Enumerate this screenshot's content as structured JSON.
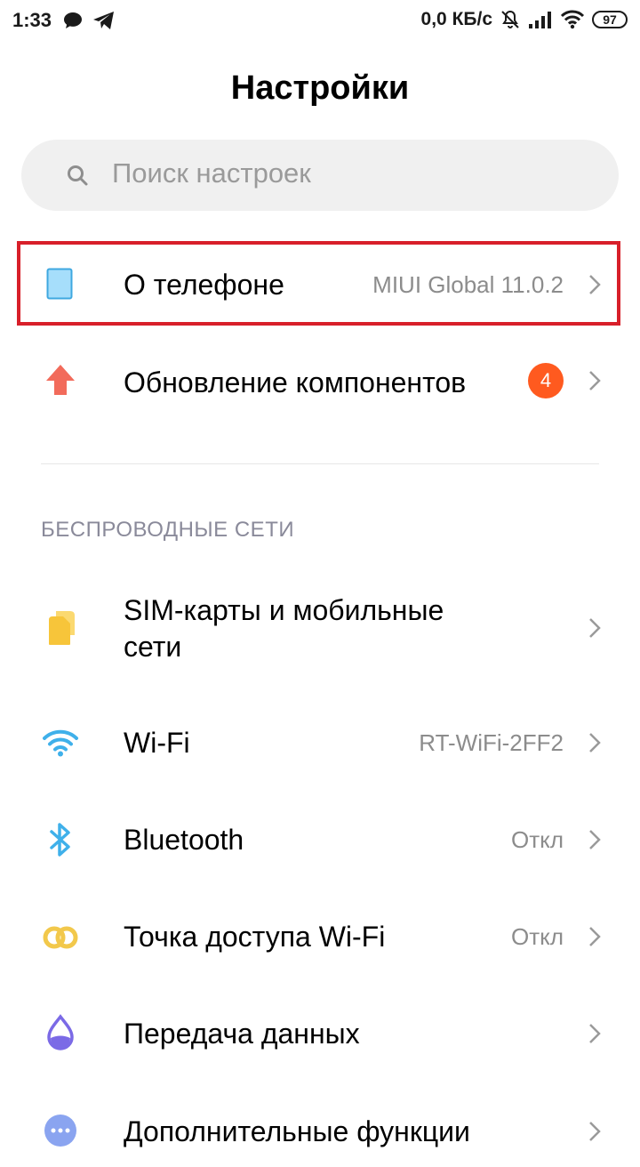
{
  "status_bar": {
    "time": "1:33",
    "net_speed": "0,0 КБ/с",
    "battery": "97",
    "icons": [
      "chat-icon",
      "telegram-icon",
      "bell-muted-icon",
      "signal-icon",
      "wifi-icon",
      "battery-icon"
    ]
  },
  "page": {
    "title": "Настройки"
  },
  "search": {
    "placeholder": "Поиск настроек"
  },
  "items": {
    "about": {
      "label": "О телефоне",
      "value": "MIUI Global 11.0.2",
      "icon": "phone-icon",
      "color": "#8fd3f0"
    },
    "updates": {
      "label": "Обновление компонентов",
      "badge": "4",
      "icon": "arrow-up-icon",
      "color": "#f26b5b"
    },
    "sim": {
      "label_line1": "SIM-карты и мобильные",
      "label_line2": "сети",
      "icon": "sim-cards-icon",
      "color": "#f7c53a"
    },
    "wifi": {
      "label": "Wi-Fi",
      "value": "RT-WiFi-2FF2",
      "icon": "wifi-icon",
      "color": "#3fb0ea"
    },
    "bluetooth": {
      "label": "Bluetooth",
      "value": "Откл",
      "icon": "bluetooth-icon",
      "color": "#3fb0ea"
    },
    "hotspot": {
      "label": "Точка доступа Wi-Fi",
      "value": "Откл",
      "icon": "hotspot-icon",
      "color": "#f2c84b"
    },
    "data": {
      "label": "Передача данных",
      "icon": "data-drop-icon",
      "color": "#7b6ae6"
    },
    "more": {
      "label": "Дополнительные функции",
      "icon": "more-icon",
      "color": "#8aa4f0"
    }
  },
  "sections": {
    "wireless": "БЕСПРОВОДНЫЕ СЕТИ"
  },
  "colors": {
    "highlight_border": "#d81f2a",
    "badge": "#ff5a1f",
    "secondary_text": "#8c8c8c"
  }
}
